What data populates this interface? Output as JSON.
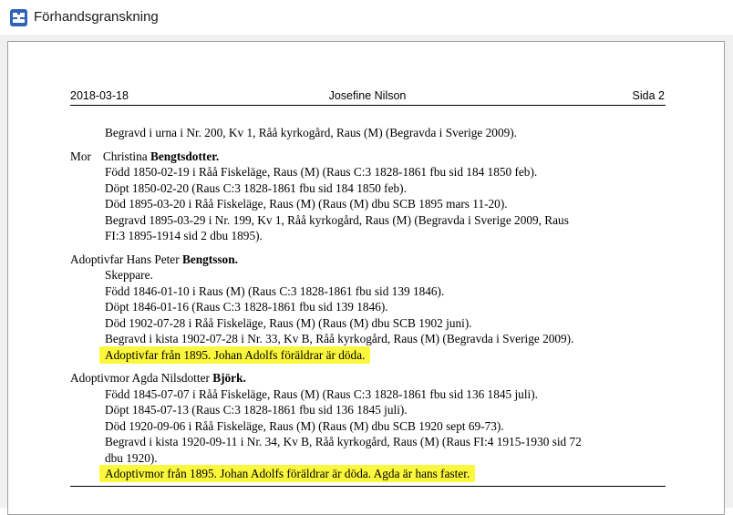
{
  "window": {
    "title": "Förhandsgranskning"
  },
  "header": {
    "date": "2018-03-18",
    "author": "Josefine Nilson",
    "page": "Sida 2"
  },
  "lines": [
    "Begravd i urna i Nr. 200, Kv 1, Råå kyrkogård, Raus (M) (Begravda i Sverige 2009).",
    "Mor",
    "Christina",
    "Bengtsdotter.",
    "Född 1850-02-19 i Råå Fiskeläge, Raus (M) (Raus C:3 1828-1861 fbu sid 184 1850 feb).",
    "Döpt 1850-02-20 (Raus C:3 1828-1861 fbu sid 184 1850 feb).",
    "Död 1895-03-20 i Råå Fiskeläge, Raus (M) (Raus (M) dbu SCB 1895 mars 11-20).",
    "Begravd 1895-03-29 i Nr. 199, Kv 1, Råå kyrkogård, Raus (M) (Begravda i Sverige 2009, Raus",
    "FI:3 1895-1914 sid 2 dbu 1895).",
    "Adoptivfar Hans Peter",
    "Bengtsson.",
    "Skeppare.",
    "Född 1846-01-10 i Raus (M) (Raus C:3 1828-1861 fbu sid 139 1846).",
    "Döpt 1846-01-16 (Raus C:3 1828-1861 fbu sid 139 1846).",
    "Död 1902-07-28 i Råå Fiskeläge, Raus (M) (Raus (M) dbu SCB 1902 juni).",
    "Begravd i kista 1902-07-28 i Nr. 33, Kv B, Råå kyrkogård, Raus (M) (Begravda i Sverige 2009).",
    "Adoptivfar från 1895. Johan Adolfs föräldrar är döda.",
    "Adoptivmor Agda Nilsdotter",
    "Björk.",
    "Född 1845-07-07 i Råå Fiskeläge, Raus (M) (Raus C:3 1828-1861 fbu sid 136 1845 juli).",
    "Döpt 1845-07-13 (Raus C:3 1828-1861 fbu sid 136 1845 juli).",
    "Död 1920-09-06 i Råå Fiskeläge, Raus (M) (Raus (M) dbu SCB 1920 sept 69-73).",
    "Begravd i kista 1920-09-11 i Nr. 34, Kv B, Råå kyrkogård, Raus (M) (Raus FI:4 1915-1930 sid 72",
    "dbu 1920).",
    "Adoptivmor från 1895. Johan Adolfs föräldrar är döda. Agda är hans faster."
  ],
  "colors": {
    "highlight": "#fbf73c",
    "app_icon": "#2e63b8",
    "workspace": "#f0f0f0"
  },
  "icons": {
    "app": "preview-app-icon"
  }
}
